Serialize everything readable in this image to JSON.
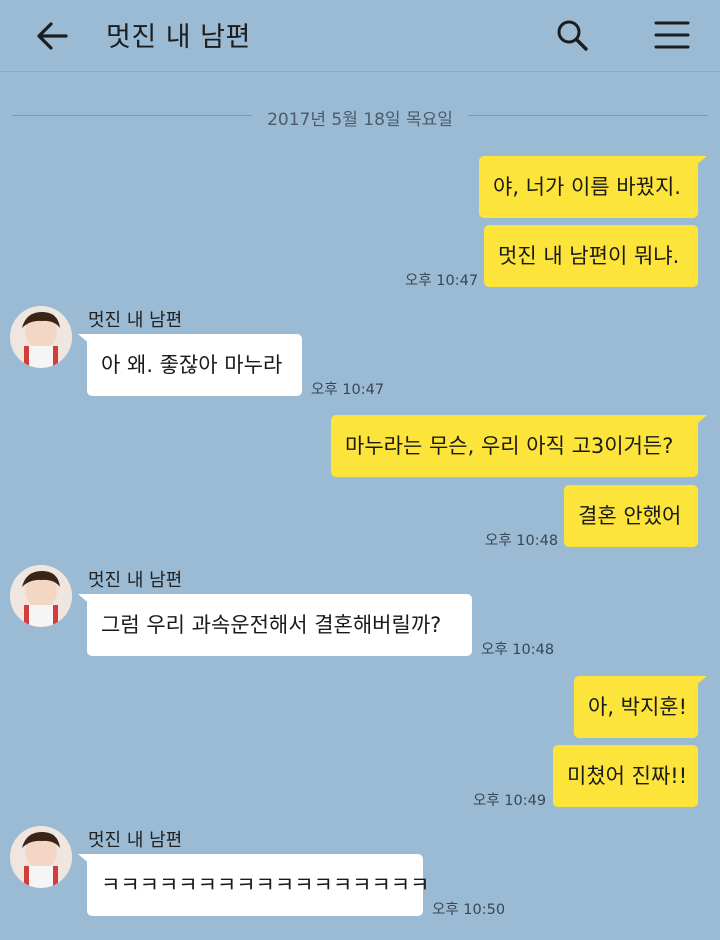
{
  "header": {
    "title": "멋진 내 남편",
    "back_icon": "arrow-left-icon",
    "search_icon": "search-icon",
    "menu_icon": "hamburger-menu-icon"
  },
  "date_divider": "2017년 5월 18일 목요일",
  "colors": {
    "background": "#9bbbd4",
    "my_bubble": "#fde43a",
    "other_bubble": "#ffffff"
  },
  "messages": [
    {
      "from": "me",
      "text": "야, 너가 이름 바꿨지."
    },
    {
      "from": "me",
      "text": "멋진 내 남편이 뭐냐.",
      "time": "오후 10:47"
    },
    {
      "from": "other",
      "sender": "멋진 내 남편",
      "text": "아 왜. 좋잖아 마누라",
      "time": "오후 10:47"
    },
    {
      "from": "me",
      "text": "마누라는 무슨, 우리 아직 고3이거든?"
    },
    {
      "from": "me",
      "text": "결혼 안했어",
      "time": "오후 10:48"
    },
    {
      "from": "other",
      "sender": "멋진 내 남편",
      "text": "그럼 우리 과속운전해서 결혼해버릴까?",
      "time": "오후 10:48"
    },
    {
      "from": "me",
      "text": "아, 박지훈!"
    },
    {
      "from": "me",
      "text": "미쳤어 진짜!!",
      "time": "오후 10:49"
    },
    {
      "from": "other",
      "sender": "멋진 내 남편",
      "text": "ㅋㅋㅋㅋㅋㅋㅋㅋㅋㅋㅋㅋㅋㅋㅋㅋㅋ",
      "time": "오후 10:50"
    }
  ]
}
